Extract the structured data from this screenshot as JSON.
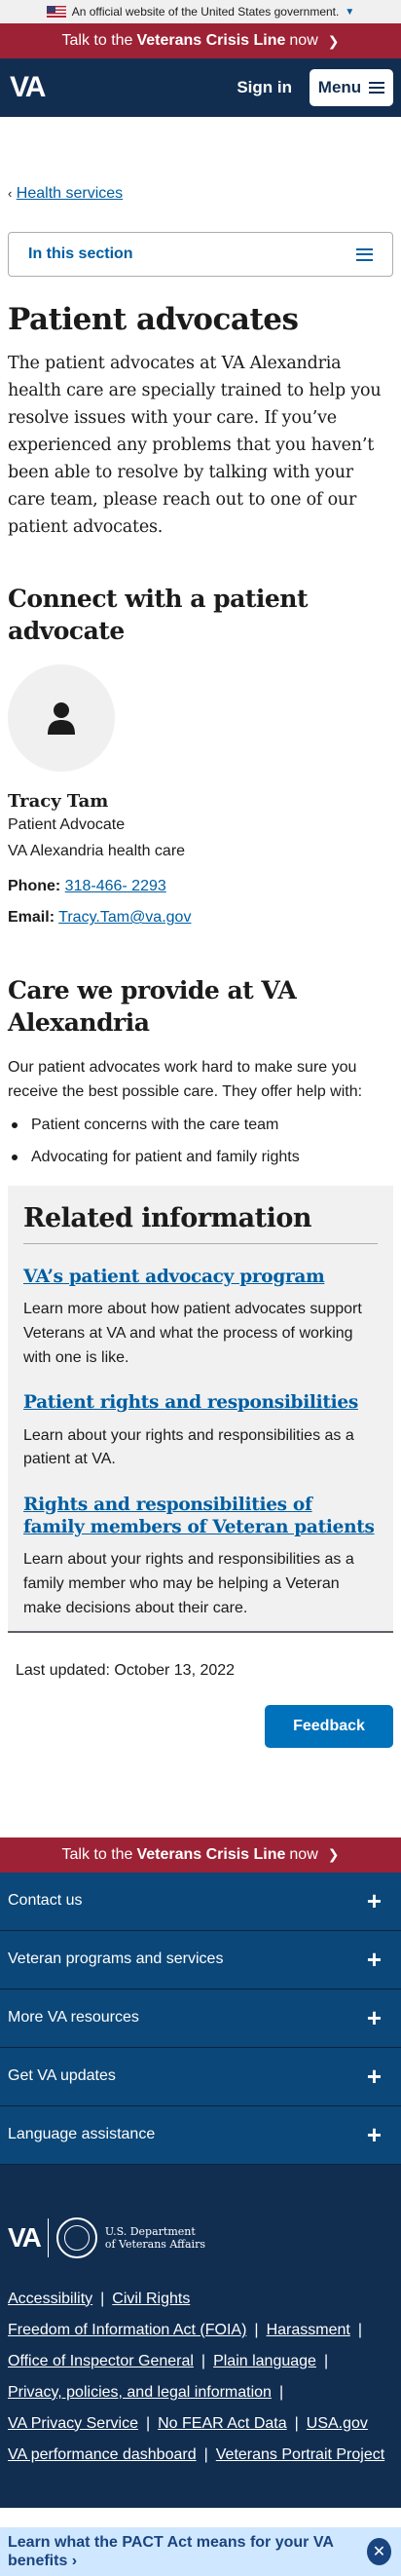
{
  "official_banner": {
    "text": "An official website of the United States government."
  },
  "crisis_banner": {
    "prefix": "Talk to the",
    "bold": "Veterans Crisis Line",
    "suffix": "now"
  },
  "header": {
    "logo": "VA",
    "sign_in": "Sign in",
    "menu": "Menu"
  },
  "breadcrumb": {
    "label": "Health services"
  },
  "in_section": {
    "label": "In this section"
  },
  "page": {
    "title": "Patient advocates",
    "intro": "The patient advocates at VA Alexandria health care are specially trained to help you resolve issues with your care. If you’ve experienced any problems that you haven’t been able to resolve by talking with your care team, please reach out to one of our patient advocates."
  },
  "connect": {
    "heading": "Connect with a patient advocate",
    "name": "Tracy Tam",
    "role": "Patient Advocate",
    "facility": "VA Alexandria health care",
    "phone_label": "Phone:",
    "phone": "318-466- 2293",
    "email_label": "Email:",
    "email": "Tracy.Tam@va.gov"
  },
  "care": {
    "heading": "Care we provide at VA Alexandria",
    "text": "Our patient advocates work hard to make sure you receive the best possible care. They offer help with:",
    "items": [
      "Patient concerns with the care team",
      "Advocating for patient and family rights"
    ]
  },
  "related": {
    "heading": "Related information",
    "items": [
      {
        "title": "VA’s patient advocacy program",
        "desc": "Learn more about how patient advocates support Veterans at VA and what the process of working with one is like."
      },
      {
        "title": "Patient rights and responsibilities",
        "desc": "Learn about your rights and responsibilities as a patient at VA."
      },
      {
        "title": "Rights and responsibilities of family members of Veteran patients",
        "desc": "Learn about your rights and responsibilities as a family member who may be helping a Veteran make decisions about their care."
      }
    ]
  },
  "last_updated": "Last updated: October 13, 2022",
  "feedback": "Feedback",
  "footer": {
    "sections": [
      "Contact us",
      "Veteran programs and services",
      "More VA resources",
      "Get VA updates",
      "Language assistance"
    ],
    "dept_line1": "U.S. Department",
    "dept_line2": "of Veterans Affairs",
    "links": {
      "accessibility": "Accessibility",
      "civil_rights": "Civil Rights",
      "foia": "Freedom of Information Act (FOIA)",
      "harassment": "Harassment",
      "oig": "Office of Inspector General",
      "plain_language": "Plain language",
      "privacy": "Privacy, policies, and legal information",
      "va_privacy": "VA Privacy Service",
      "no_fear": "No FEAR Act Data",
      "usa_gov": "USA.gov",
      "performance": "VA performance dashboard",
      "portrait": "Veterans Portrait Project"
    }
  },
  "pact_banner": {
    "text": "Learn what the PACT Act means for your VA benefits"
  },
  "colors": {
    "navy": "#112e51",
    "crisis_red": "#9d2235",
    "link_blue": "#005ea2",
    "button_blue": "#0071bb",
    "footer_accordion": "#0b4778",
    "pact_bg": "#cfe8ff"
  }
}
